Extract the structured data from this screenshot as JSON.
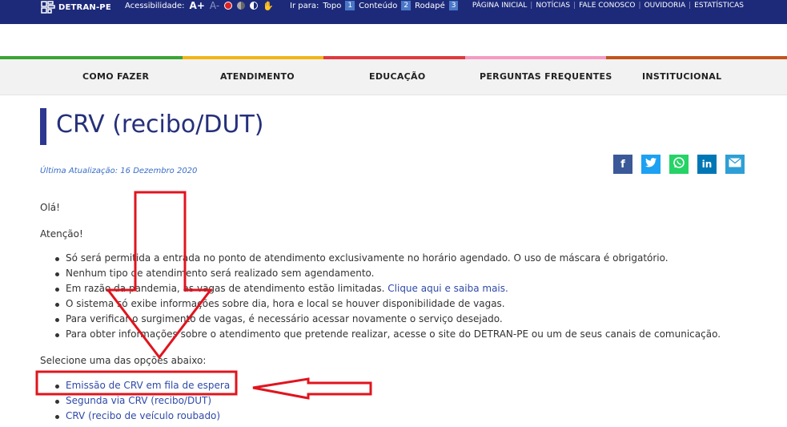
{
  "topbar": {
    "logo": "DETRAN-PE",
    "accessibility_label": "Acessibilidade:",
    "font_increase": "A+",
    "font_decrease": "A-",
    "goto_label": "Ir para:",
    "goto_items": [
      {
        "label": "Topo",
        "num": "1"
      },
      {
        "label": "Conteúdo",
        "num": "2"
      },
      {
        "label": "Rodapé",
        "num": "3"
      }
    ],
    "links": [
      "PÁGINA INICIAL",
      "NOTÍCIAS",
      "FALE CONOSCO",
      "OUVIDORIA",
      "ESTATÍSTICAS"
    ]
  },
  "stripe_colors": [
    "#3aa535",
    "#f2b515",
    "#e0393e",
    "#f49ac1",
    "#c2541b"
  ],
  "nav": [
    "COMO FAZER",
    "ATENDIMENTO",
    "EDUCAÇÃO",
    "PERGUNTAS FREQUENTES",
    "INSTITUCIONAL"
  ],
  "page": {
    "title": "CRV (recibo/DUT)",
    "updated": "Última Atualização: 16 Dezembro 2020",
    "greeting": "Olá!",
    "attention": "Atenção!",
    "bullets": [
      {
        "text": "Só será permitida a entrada no ponto de atendimento exclusivamente no horário agendado. O uso de máscara é obrigatório.",
        "link": ""
      },
      {
        "text": "Nenhum tipo de atendimento será realizado sem agendamento.",
        "link": ""
      },
      {
        "text": "Em razão da pandemia, as vagas de atendimento estão limitadas. ",
        "link": "Clique aqui e saiba mais."
      },
      {
        "text": "O sistema só exibe informações sobre dia, hora e local se houver disponibilidade de vagas.",
        "link": ""
      },
      {
        "text": "Para verificar o surgimento de vagas, é necessário acessar novamente o serviço desejado.",
        "link": ""
      },
      {
        "text": "Para obter informações sobre o atendimento que pretende realizar, acesse o site do DETRAN-PE ou um de seus canais de comunicação.",
        "link": ""
      }
    ],
    "select_label": "Selecione uma das opções abaixo:",
    "options": [
      "Emissão de CRV em fila de espera",
      "Segunda via CRV (recibo/DUT)",
      "CRV (recibo de veículo roubado)"
    ]
  },
  "share": [
    {
      "icon": "facebook-icon",
      "glyph": "f",
      "color": "#3b5998"
    },
    {
      "icon": "twitter-icon",
      "glyph": "t",
      "color": "#1da1f2"
    },
    {
      "icon": "whatsapp-icon",
      "glyph": "w",
      "color": "#25d366"
    },
    {
      "icon": "linkedin-icon",
      "glyph": "in",
      "color": "#0077b5"
    },
    {
      "icon": "email-icon",
      "glyph": "✉",
      "color": "#2e9fd6"
    }
  ],
  "annotation_color": "#e0141e"
}
